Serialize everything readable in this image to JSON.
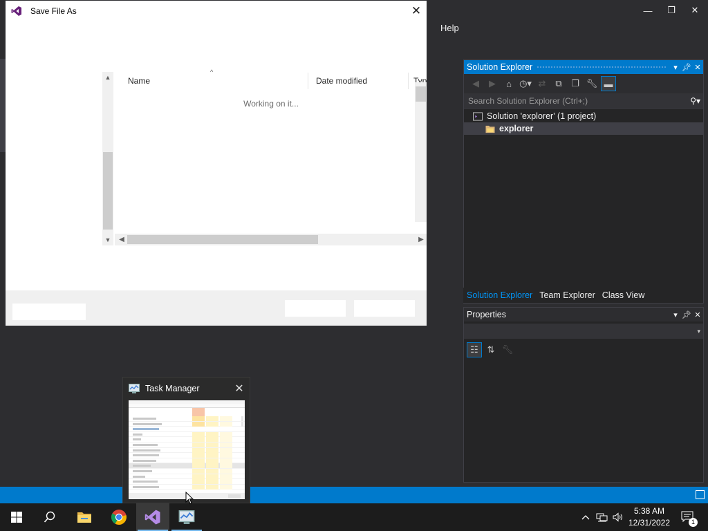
{
  "vs": {
    "menu_help": "Help",
    "caption_min": "—",
    "caption_restore": "❐",
    "caption_close": "✕"
  },
  "solution_explorer": {
    "title": "Solution Explorer",
    "search_placeholder": "Search Solution Explorer (Ctrl+;)",
    "solution_label": "Solution 'explorer' (1 project)",
    "project_label": "explorer",
    "tabs": [
      "Solution Explorer",
      "Team Explorer",
      "Class View"
    ]
  },
  "properties": {
    "title": "Properties"
  },
  "save_dialog": {
    "title": "Save File As",
    "columns": [
      "Name",
      "Date modified",
      "Type"
    ],
    "status": "Working on it..."
  },
  "task_manager_thumb": {
    "title": "Task Manager"
  },
  "taskbar": {
    "time": "5:38 AM",
    "date": "12/31/2022",
    "notification_count": "1"
  },
  "colors": {
    "accent": "#007acc",
    "vs_bg": "#2d2d30",
    "taskbar_bg": "#1c1c1c"
  }
}
